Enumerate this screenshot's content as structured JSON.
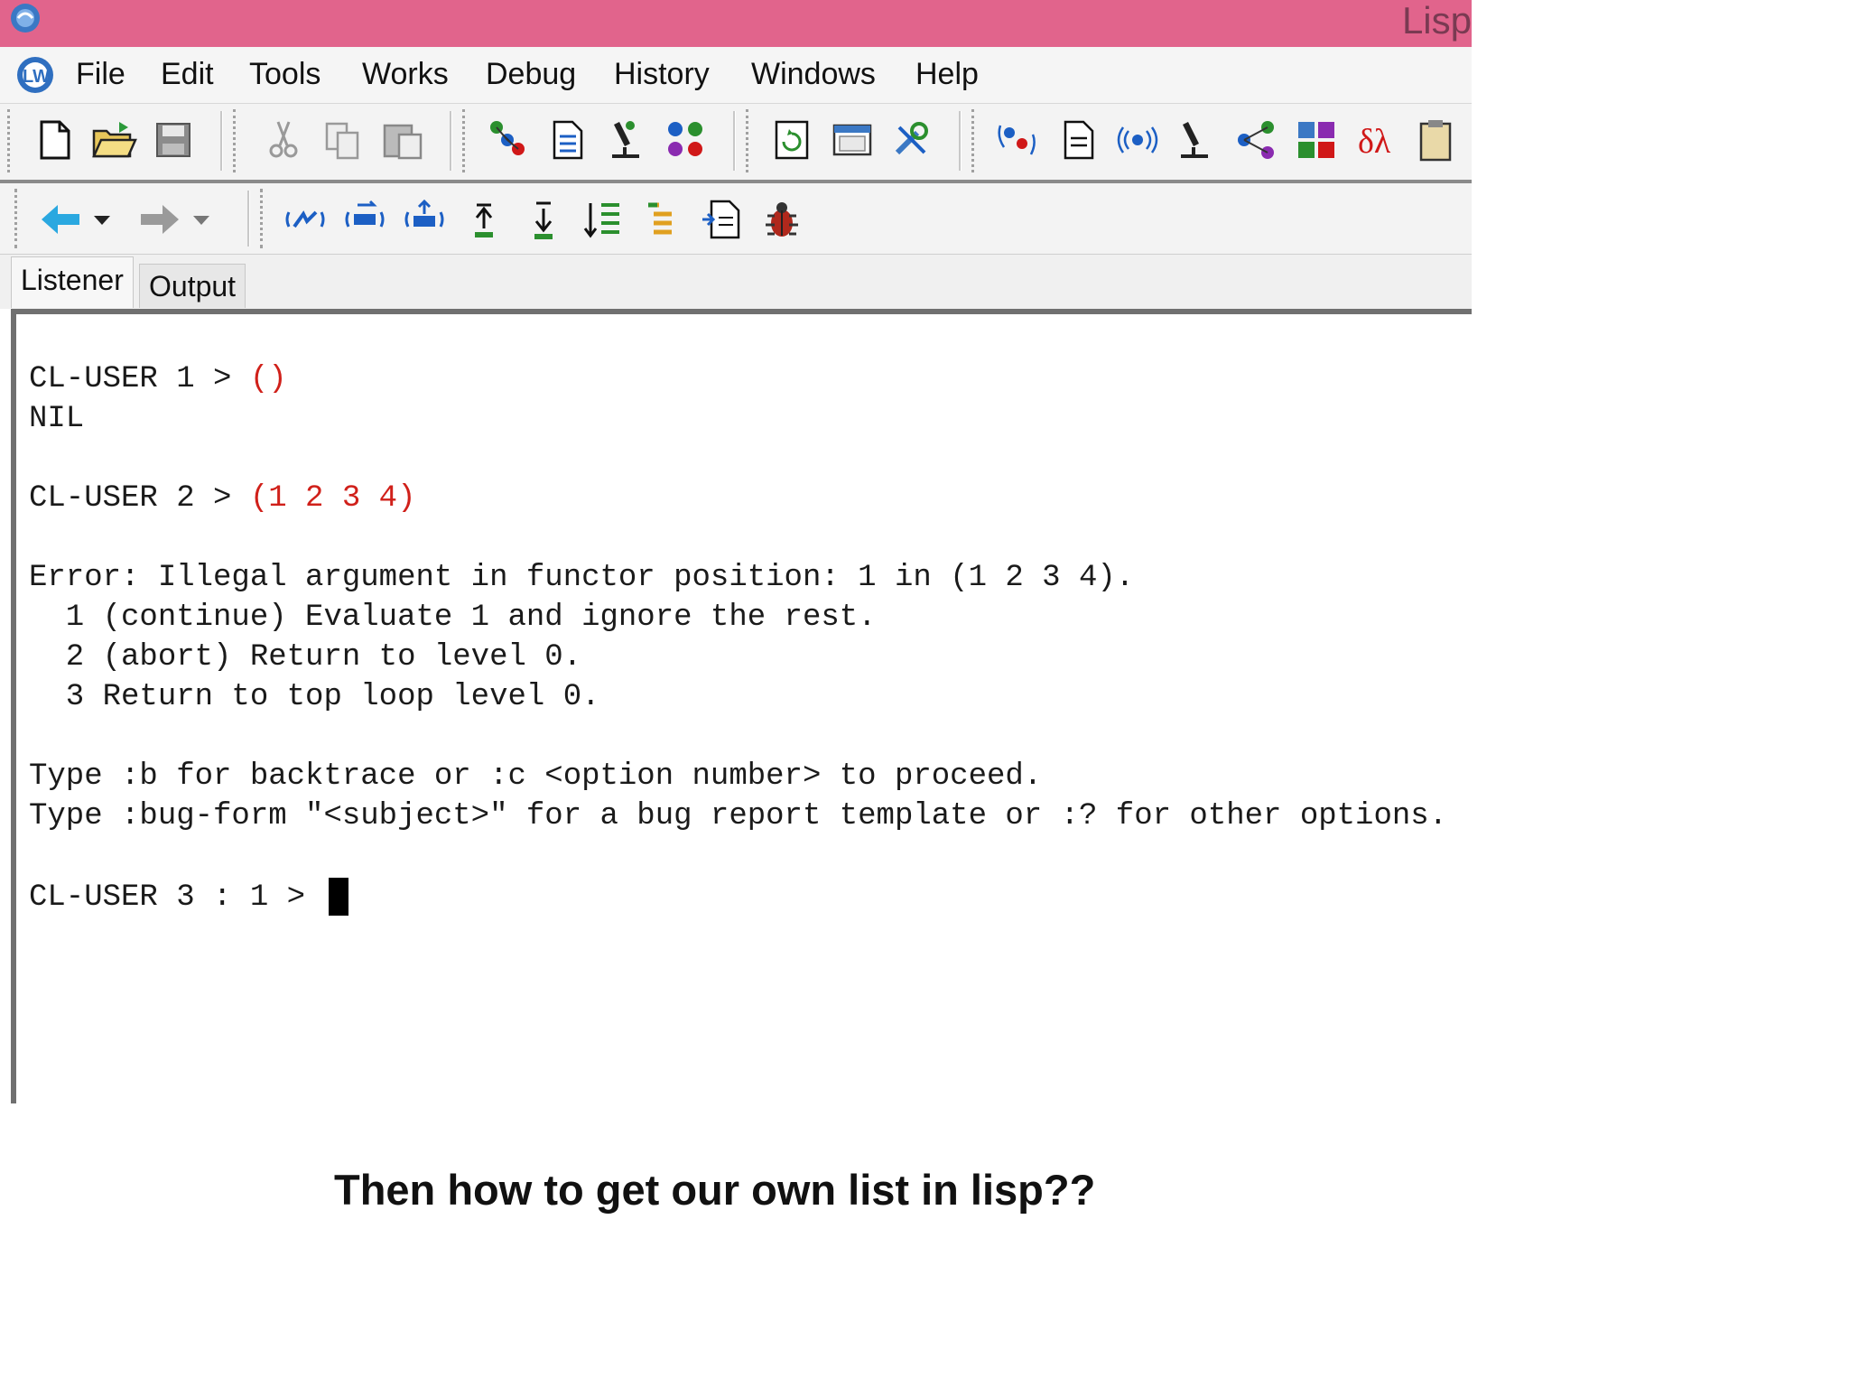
{
  "window": {
    "title": "Lisp"
  },
  "menubar": {
    "items": [
      "File",
      "Edit",
      "Tools",
      "Works",
      "Debug",
      "History",
      "Windows",
      "Help"
    ]
  },
  "toolbar1": {
    "icons": [
      "new-file-icon",
      "open-folder-icon",
      "save-icon",
      "cut-icon",
      "copy-icon",
      "paste-icon",
      "inspector-icon",
      "listener-doc-icon",
      "microscope-icon",
      "class-browser-icon",
      "refresh-window-icon",
      "window-browser-icon",
      "tools-icon",
      "tracer-icon",
      "editor-doc-icon",
      "radio-icon",
      "profiler-icon",
      "graph-icon",
      "grid-icon",
      "symbol-icon",
      "clipboard-icon"
    ]
  },
  "toolbar2": {
    "icons": [
      "back-arrow-icon",
      "back-dropdown-icon",
      "forward-arrow-icon",
      "forward-dropdown-icon",
      "abort-icon",
      "continue-icon",
      "restart-icon",
      "up-frame-icon",
      "down-frame-icon",
      "frames-icon",
      "stack-icon",
      "find-source-icon",
      "bug-icon"
    ]
  },
  "tabs": [
    {
      "label": "Listener",
      "active": true
    },
    {
      "label": "Output",
      "active": false
    }
  ],
  "console": {
    "prompt1": "CL-USER 1 > ",
    "input1": "()",
    "result1": "NIL",
    "prompt2": "CL-USER 2 > ",
    "input2": "(1 2 3 4)",
    "error": "Error: Illegal argument in functor position: 1 in (1 2 3 4).",
    "restart1": "  1 (continue) Evaluate 1 and ignore the rest.",
    "restart2": "  2 (abort) Return to level 0.",
    "restart3": "  3 Return to top loop level 0.",
    "hint1": "Type :b for backtrace or :c <option number> to proceed.",
    "hint2": "Type :bug-form \"<subject>\" for a bug report template or :? for other options.",
    "prompt3": "CL-USER 3 : 1 > "
  },
  "caption": "Then how to get our own list in lisp??",
  "colors": {
    "titlebar": "#e1648c",
    "code_input": "#d0201a"
  }
}
